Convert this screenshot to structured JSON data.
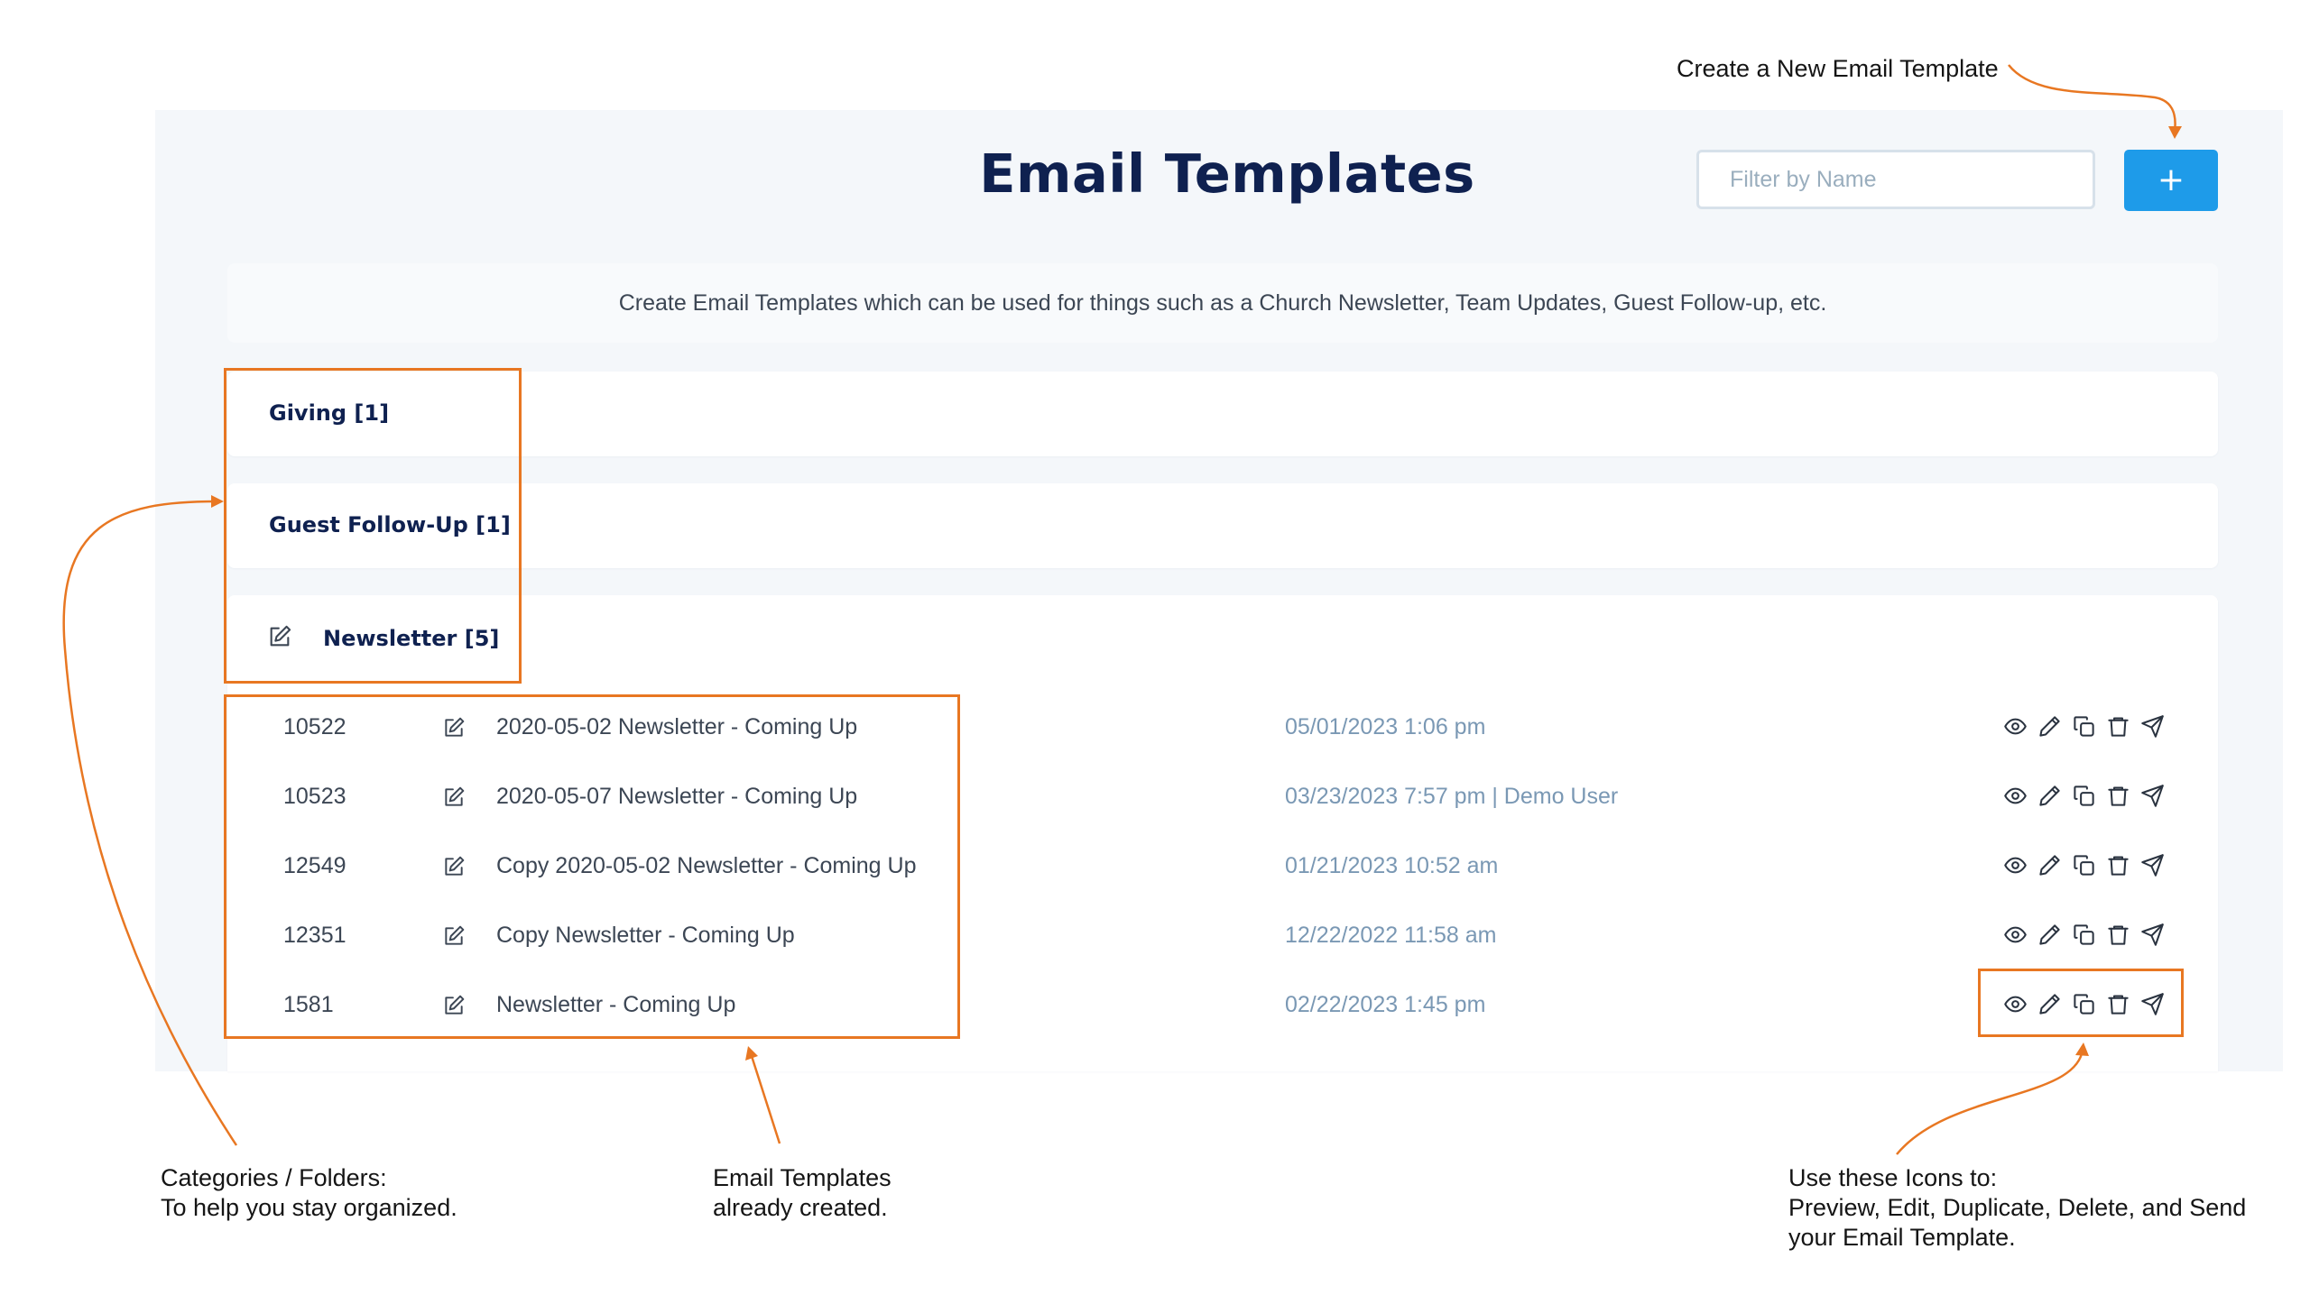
{
  "header": {
    "title": "Email Templates",
    "filter_placeholder": "Filter by Name",
    "add_label": "+"
  },
  "description": "Create Email Templates which can be used for things such as a Church Newsletter, Team Updates, Guest Follow-up, etc.",
  "categories": [
    {
      "label": "Giving [1]"
    },
    {
      "label": "Guest Follow-Up [1]"
    },
    {
      "label": "Newsletter [5]"
    }
  ],
  "templates": [
    {
      "id": "10522",
      "name": "2020-05-02 Newsletter - Coming Up",
      "date": "05/01/2023 1:06 pm"
    },
    {
      "id": "10523",
      "name": "2020-05-07 Newsletter - Coming Up",
      "date": "03/23/2023 7:57 pm | Demo User"
    },
    {
      "id": "12549",
      "name": "Copy 2020-05-02 Newsletter - Coming Up",
      "date": "01/21/2023 10:52 am"
    },
    {
      "id": "12351",
      "name": "Copy Newsletter - Coming Up",
      "date": "12/22/2022 11:58 am"
    },
    {
      "id": "1581",
      "name": "Newsletter - Coming Up",
      "date": "02/22/2023 1:45 pm"
    }
  ],
  "row_action_icons": [
    "eye-icon",
    "pencil-icon",
    "copy-icon",
    "trash-icon",
    "send-icon"
  ],
  "annotations": {
    "create": "Create a New Email Template",
    "categories": [
      "Categories / Folders:",
      "To help you stay organized."
    ],
    "templates": [
      "Email Templates",
      "already created."
    ],
    "icons": [
      "Use these Icons to:",
      "Preview, Edit, Duplicate, Delete, and Send",
      "your Email Template."
    ]
  },
  "colors": {
    "title": "#0f2150",
    "accent": "#1e9be9",
    "annotation": "#e87722",
    "date_text": "#7a98b4",
    "panel_bg": "#f4f7fa"
  }
}
